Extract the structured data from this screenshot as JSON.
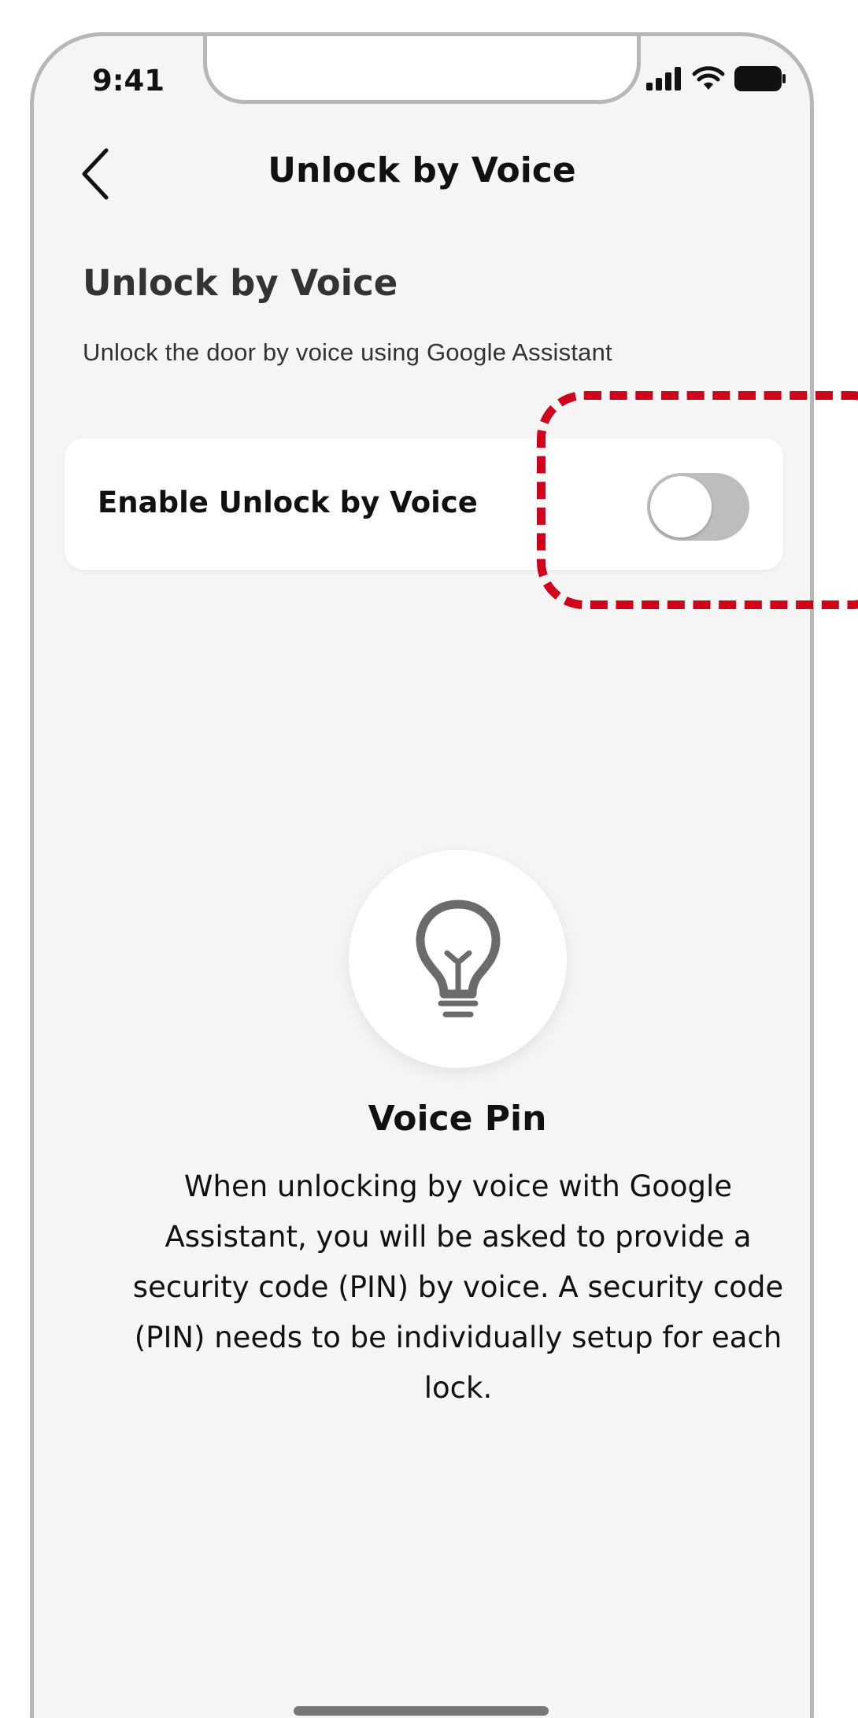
{
  "status_bar": {
    "time": "9:41",
    "icons": [
      "cellular-signal-icon",
      "wifi-icon",
      "battery-icon"
    ]
  },
  "nav": {
    "back_icon": "chevron-left-icon",
    "title": "Unlock by Voice"
  },
  "section": {
    "title": "Unlock by Voice",
    "description": "Unlock the door by voice using Google Assistant"
  },
  "toggle": {
    "label": "Enable Unlock by Voice",
    "enabled": false
  },
  "tip": {
    "icon": "lightbulb-icon",
    "title": "Voice Pin",
    "body": "When unlocking by voice with Google Assistant, you will be asked to provide a security code (PIN) by voice. A security code (PIN) needs to be individually setup for each lock."
  },
  "colors": {
    "highlight": "#d0021b",
    "switch_off": "#bdbdbd",
    "background": "#f5f5f5",
    "icon_gray": "#6b6b6b"
  }
}
